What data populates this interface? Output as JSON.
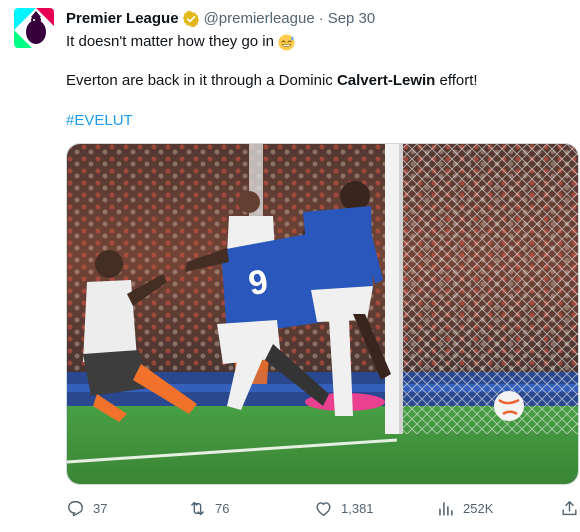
{
  "tweet": {
    "author_name": "Premier League",
    "handle": "@premierleague",
    "separator": "·",
    "date": "Sep 30",
    "line1": "It doesn't matter how they go in",
    "line2_pre": "Everton are back in it through a Dominic ",
    "line2_bold": "Calvert-Lewin",
    "line2_post": " effort!",
    "hashtag": "#EVELUT"
  },
  "icons": {
    "avatar": "premier-league-lion-logo",
    "verified": "gold-verified-badge",
    "emoji": "grinning-sweat-emoji",
    "reply": "reply-icon",
    "retweet": "retweet-icon",
    "like": "heart-icon",
    "views": "views-bar-chart-icon",
    "share": "share-upload-icon"
  },
  "actions": {
    "replies": "37",
    "retweets": "76",
    "likes": "1,381",
    "views": "252K"
  },
  "colors": {
    "text": "#0f1419",
    "secondary": "#536471",
    "link": "#1d9bf0",
    "verified_gold": "#e2b719",
    "everton_blue": "#1f4fb8",
    "luton_orange": "#f26b21"
  }
}
